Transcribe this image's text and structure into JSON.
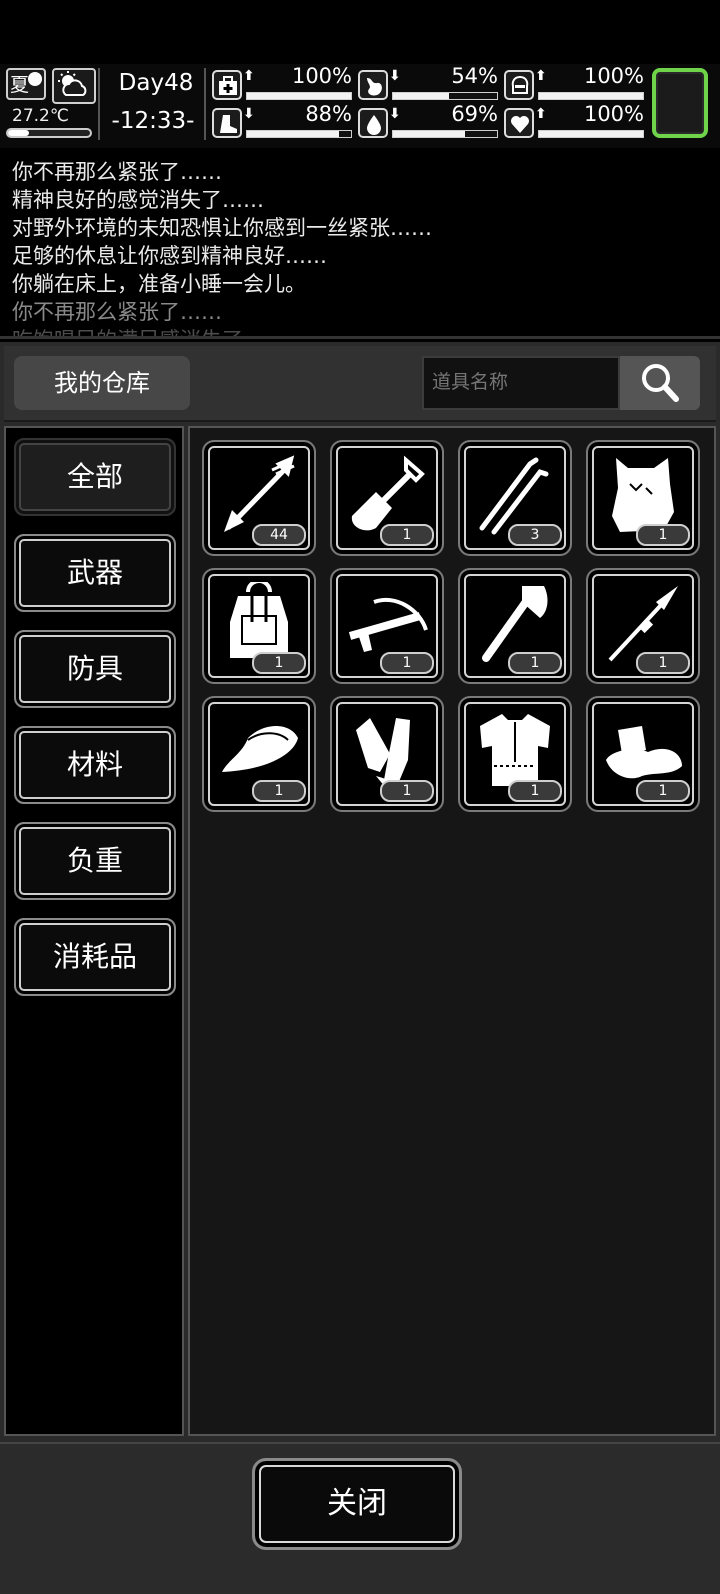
{
  "status": {
    "season": "夏",
    "temperature": "27.2℃",
    "temperature_level": 0.26,
    "day": "Day48",
    "time": "-12:33-",
    "stats": [
      {
        "name": "health",
        "icon": "medkit-icon",
        "trend": "up",
        "value": "100%",
        "level": 1.0
      },
      {
        "name": "hunger",
        "icon": "stomach-icon",
        "trend": "down",
        "value": "54%",
        "level": 0.54
      },
      {
        "name": "sanity",
        "icon": "mind-icon",
        "trend": "up",
        "value": "100%",
        "level": 1.0
      },
      {
        "name": "stamina",
        "icon": "boot-icon",
        "trend": "down",
        "value": "88%",
        "level": 0.88
      },
      {
        "name": "thirst",
        "icon": "water-drop-icon",
        "trend": "down",
        "value": "69%",
        "level": 0.69
      },
      {
        "name": "mood",
        "icon": "heart-icon",
        "trend": "up",
        "value": "100%",
        "level": 1.0
      }
    ],
    "accent_color": "#6fd44a"
  },
  "log": [
    "你不再那么紧张了……",
    "精神良好的感觉消失了……",
    "对野外环境的未知恐惧让你感到一丝紧张……",
    "足够的休息让你感到精神良好……",
    "你躺在床上，准备小睡一会儿。",
    "你不再那么紧张了……",
    "吃饱喝足的满足感消失了……"
  ],
  "warehouse": {
    "title": "我的仓库",
    "search_placeholder": "道具名称",
    "categories": [
      "全部",
      "武器",
      "防具",
      "材料",
      "负重",
      "消耗品"
    ],
    "active_category": "全部",
    "items": [
      {
        "icon": "arrow-icon",
        "count": "44"
      },
      {
        "icon": "shovel-icon",
        "count": "1"
      },
      {
        "icon": "lockpick-icon",
        "count": "3"
      },
      {
        "icon": "fur-pelt-icon",
        "count": "1"
      },
      {
        "icon": "backpack-icon",
        "count": "1"
      },
      {
        "icon": "crossbow-icon",
        "count": "1"
      },
      {
        "icon": "axe-icon",
        "count": "1"
      },
      {
        "icon": "spear-icon",
        "count": "1"
      },
      {
        "icon": "hat-icon",
        "count": "1"
      },
      {
        "icon": "gloves-icon",
        "count": "1"
      },
      {
        "icon": "fur-armor-icon",
        "count": "1"
      },
      {
        "icon": "fur-boots-icon",
        "count": "1"
      }
    ],
    "close_label": "关闭"
  }
}
